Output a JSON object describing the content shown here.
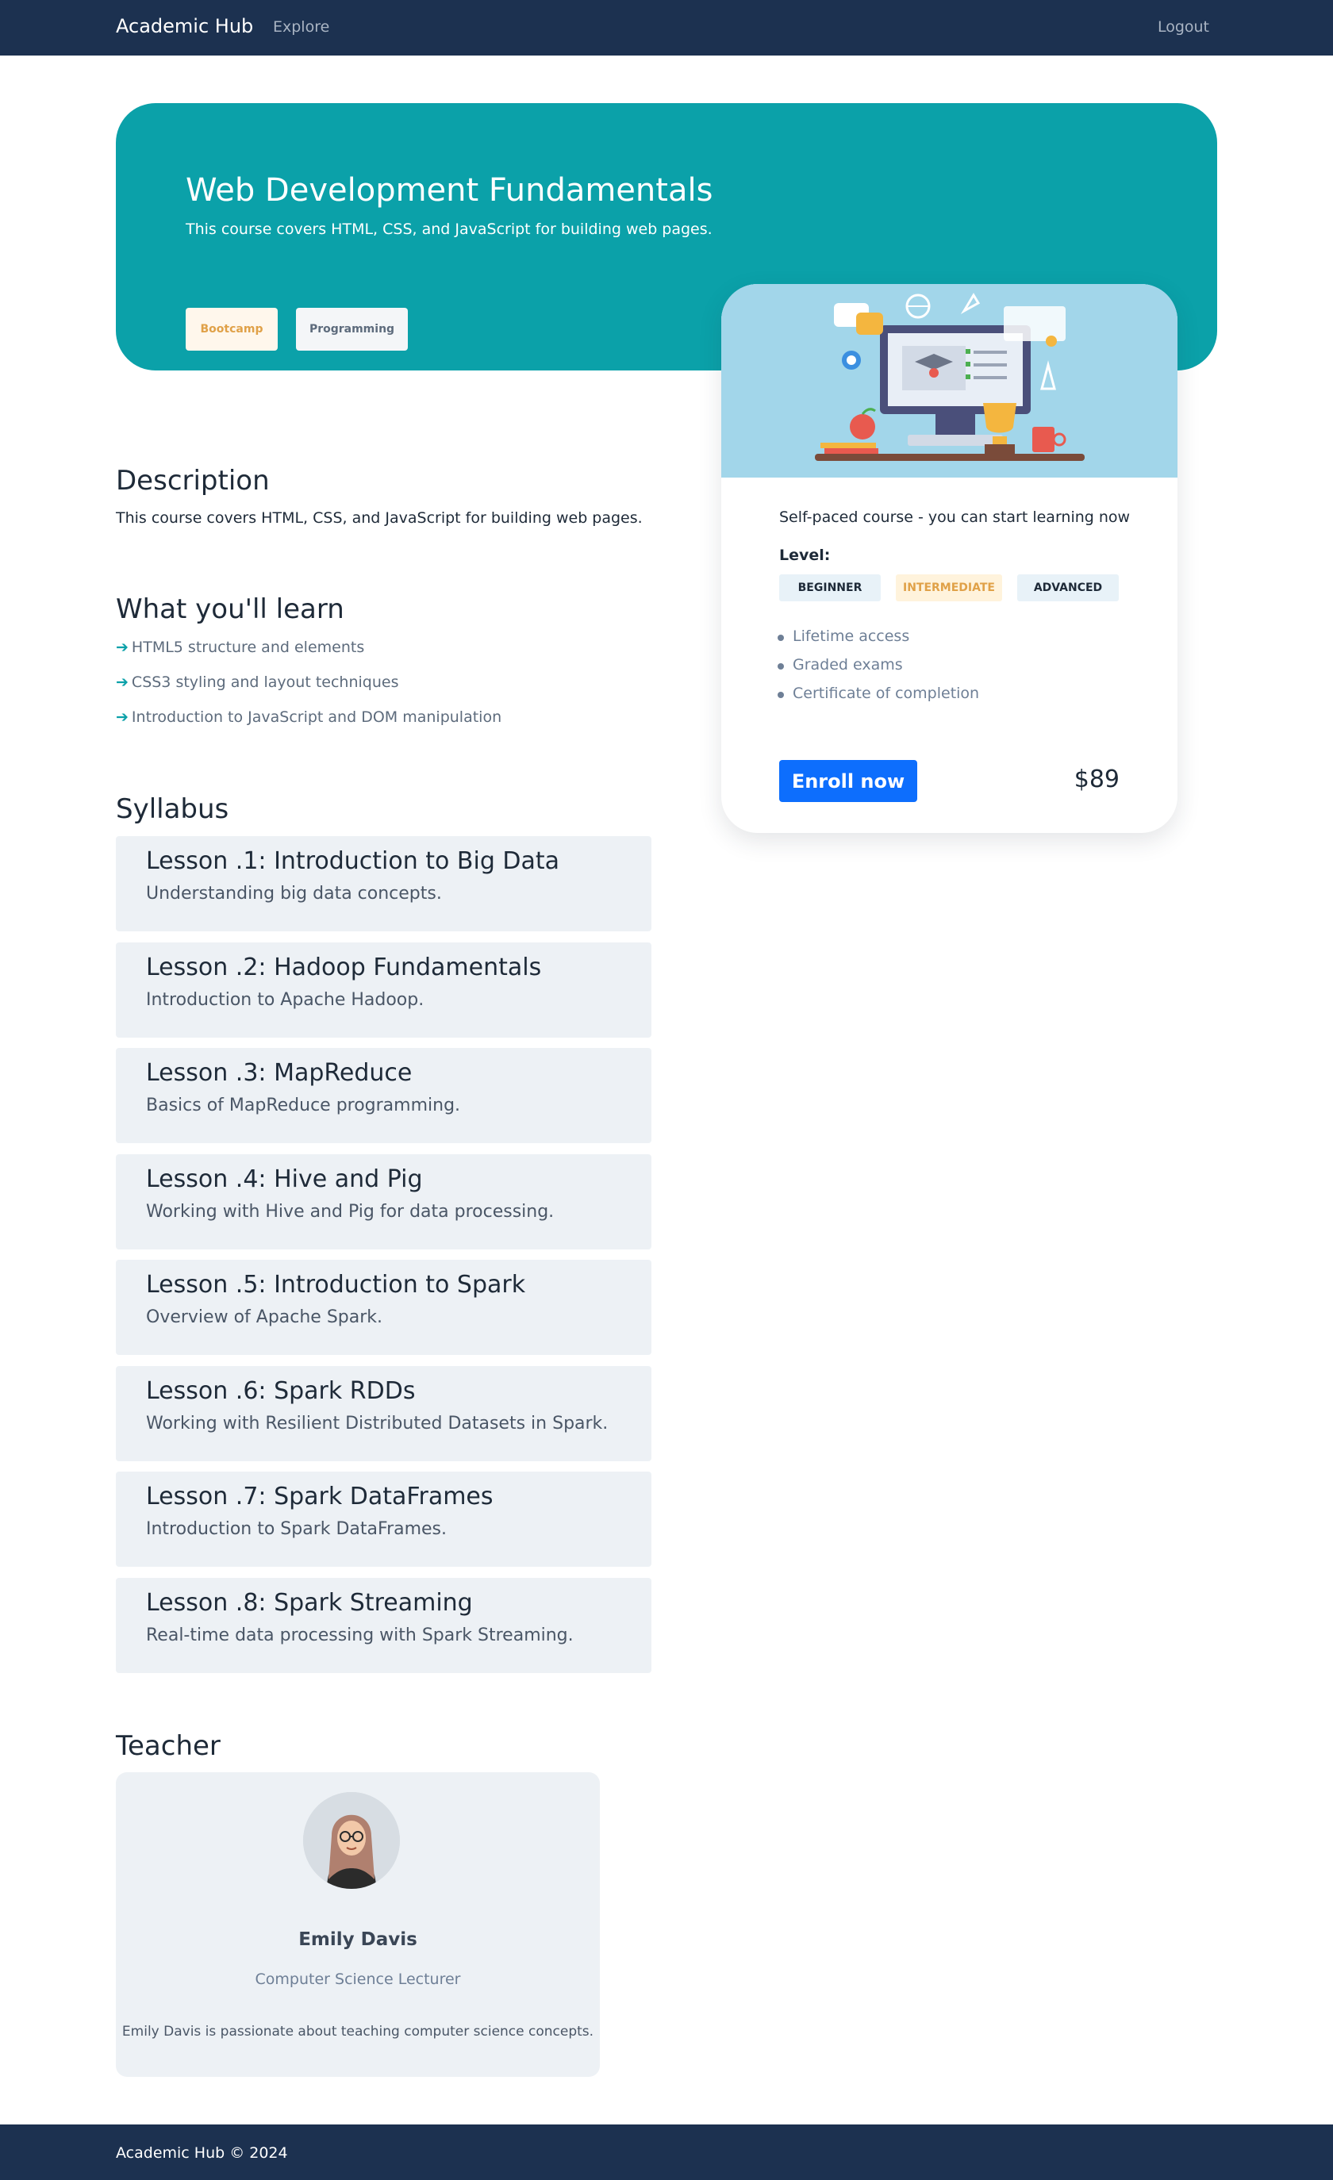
{
  "navbar": {
    "brand": "Academic Hub",
    "explore": "Explore",
    "logout": "Logout"
  },
  "hero": {
    "title": "Web Development Fundamentals",
    "subtitle": "This course covers HTML, CSS, and JavaScript for building web pages.",
    "tags": [
      "Bootcamp",
      "Programming"
    ]
  },
  "card": {
    "pace": "Self-paced course - you can start learning now",
    "level_label": "Level:",
    "levels": [
      "BEGINNER",
      "INTERMEDIATE",
      "ADVANCED"
    ],
    "features": [
      "Lifetime access",
      "Graded exams",
      "Certificate of completion"
    ],
    "enroll_label": "Enroll now",
    "price": "$89"
  },
  "description": {
    "heading": "Description",
    "text": "This course covers HTML, CSS, and JavaScript for building web pages."
  },
  "learn": {
    "heading": "What you'll learn",
    "items": [
      "HTML5 structure and elements",
      "CSS3 styling and layout techniques",
      "Introduction to JavaScript and DOM manipulation"
    ]
  },
  "syllabus": {
    "heading": "Syllabus",
    "lessons": [
      {
        "title": "Lesson .1: Introduction to Big Data",
        "desc": "Understanding big data concepts."
      },
      {
        "title": "Lesson .2: Hadoop Fundamentals",
        "desc": "Introduction to Apache Hadoop."
      },
      {
        "title": "Lesson .3: MapReduce",
        "desc": "Basics of MapReduce programming."
      },
      {
        "title": "Lesson .4: Hive and Pig",
        "desc": "Working with Hive and Pig for data processing."
      },
      {
        "title": "Lesson .5: Introduction to Spark",
        "desc": "Overview of Apache Spark."
      },
      {
        "title": "Lesson .6: Spark RDDs",
        "desc": "Working with Resilient Distributed Datasets in Spark."
      },
      {
        "title": "Lesson .7: Spark DataFrames",
        "desc": "Introduction to Spark DataFrames."
      },
      {
        "title": "Lesson .8: Spark Streaming",
        "desc": "Real-time data processing with Spark Streaming."
      }
    ]
  },
  "teacher": {
    "heading": "Teacher",
    "name": "Emily Davis",
    "role": "Computer Science Lecturer",
    "bio": "Emily Davis is passionate about teaching computer science concepts."
  },
  "footer": {
    "text": "Academic Hub © 2024"
  },
  "colors": {
    "nav": "#1c3150",
    "hero": "#0ba1a9",
    "accent": "#0d6efd",
    "lesson_bg": "#edf1f5"
  }
}
